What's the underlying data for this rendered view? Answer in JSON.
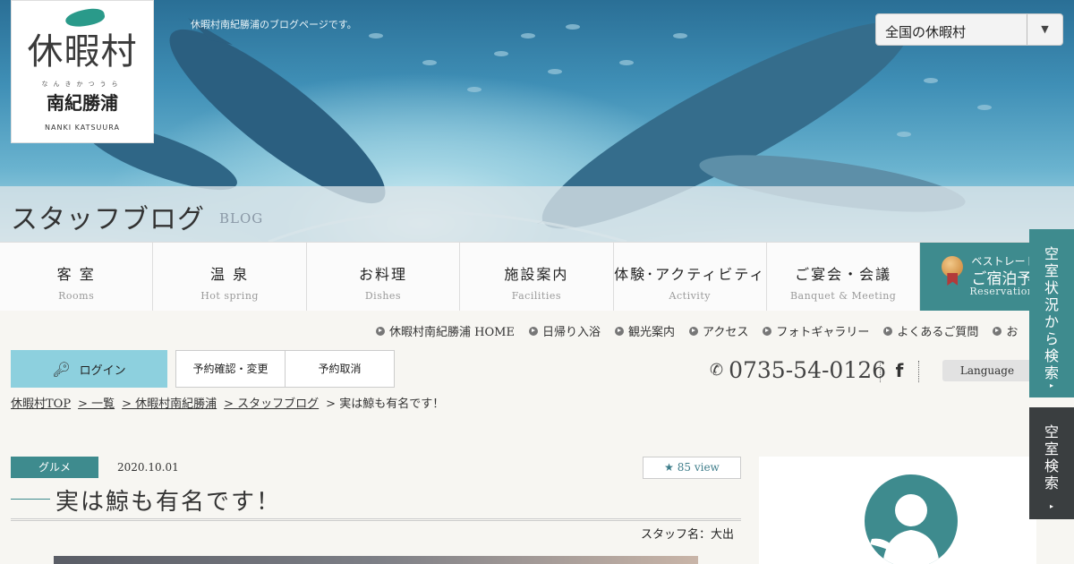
{
  "header": {
    "logo": {
      "name": "休暇村",
      "ruby": "なんきかつうら",
      "place": "南紀勝浦",
      "romaji": "NANKI KATSUURA"
    },
    "tagline": "休暇村南紀勝浦のブログページです。",
    "region_select": {
      "value": "全国の休暇村",
      "arrow": "▼"
    },
    "page_title": "スタッフブログ",
    "page_title_en": "BLOG"
  },
  "nav": {
    "items": [
      {
        "ja": "客 室",
        "en": "Rooms"
      },
      {
        "ja": "温 泉",
        "en": "Hot spring"
      },
      {
        "ja": "お料理",
        "en": "Dishes"
      },
      {
        "ja": "施設案内",
        "en": "Facilities"
      },
      {
        "ja": "体験･アクティビティ",
        "en": "Activity"
      },
      {
        "ja": "ご宴会・会議",
        "en": "Banquet & Meeting"
      }
    ],
    "reserve": {
      "top": "ベストレート保",
      "main": "ご宿泊予",
      "en": "Reservation"
    }
  },
  "sublinks": [
    "休暇村南紀勝浦 HOME",
    "日帰り入浴",
    "観光案内",
    "アクセス",
    "フォトギャラリー",
    "よくあるご質問",
    "お"
  ],
  "account": {
    "login": "ログイン",
    "confirm": "予約確認・変更",
    "cancel": "予約取消",
    "phone": "0735-54-0126",
    "facebook": "f",
    "language": "Language"
  },
  "breadcrumb": [
    "休暇村TOP",
    "> 一覧",
    "> 休暇村南紀勝浦",
    "> スタッフブログ",
    "> 実は鯨も有名です！"
  ],
  "post": {
    "category": "グルメ",
    "date": "2020.10.01",
    "views": "★ 85 view",
    "title": "実は鯨も有名です！",
    "staff": "スタッフ名：大出"
  },
  "side_tabs": {
    "availability": "空室状況から検索",
    "room_search": "空室検索"
  },
  "colors": {
    "teal": "#3e8b8e",
    "login": "#8dd0de",
    "dark_tab": "#3a3e40"
  }
}
